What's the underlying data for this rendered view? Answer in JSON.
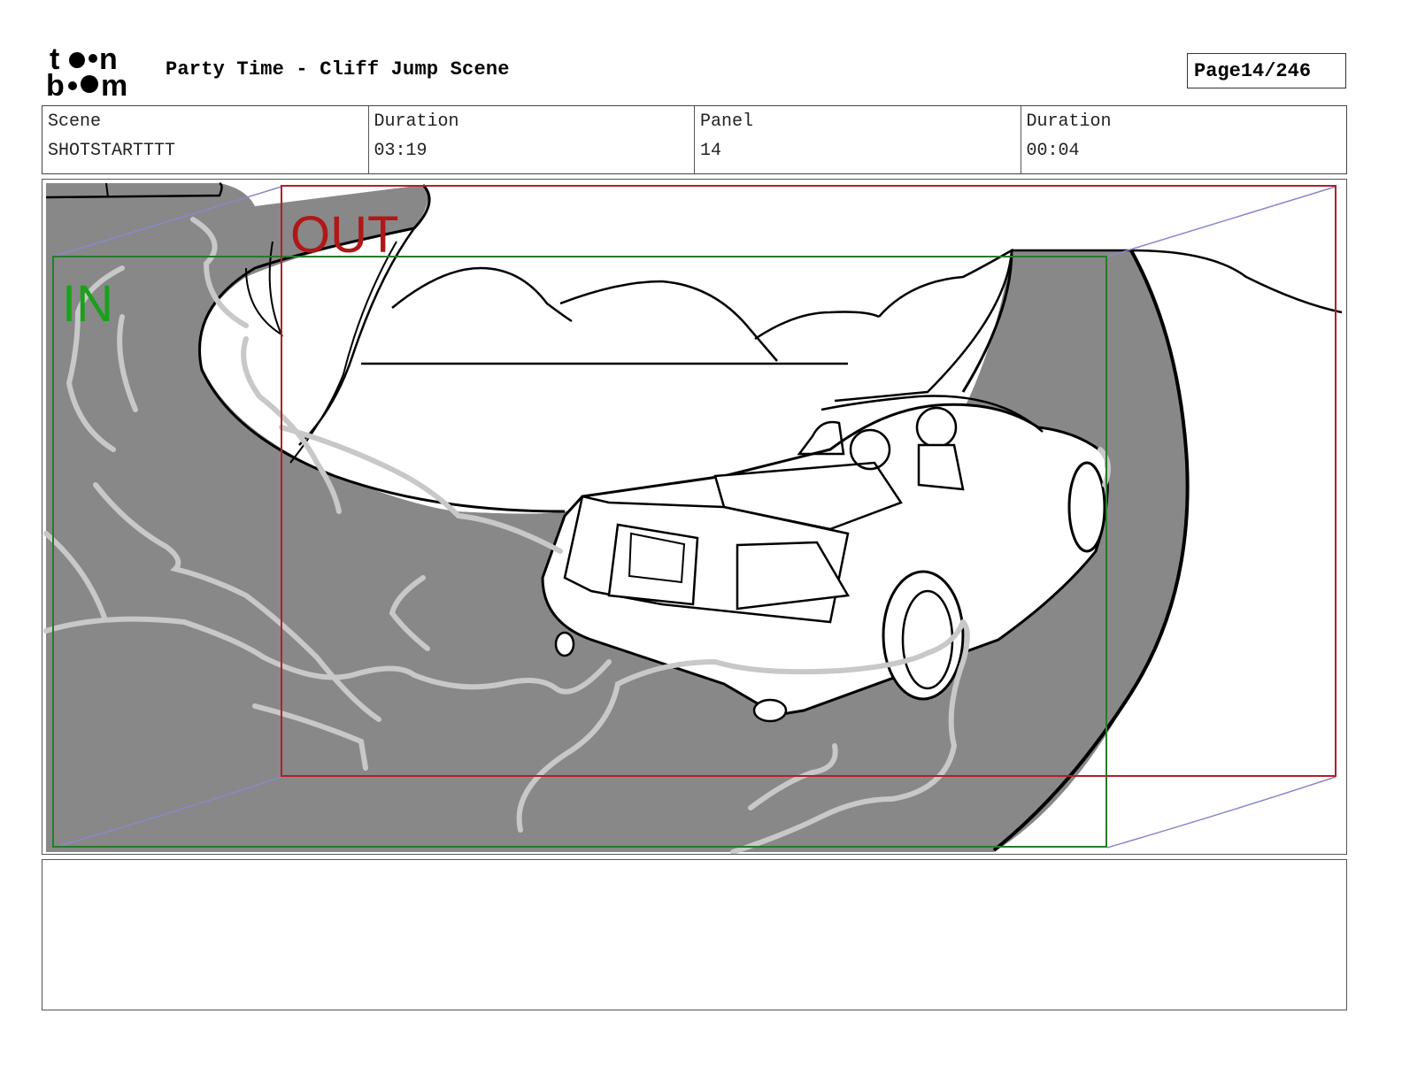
{
  "header": {
    "logo_text": "toon boom",
    "title": "Party Time - Cliff Jump Scene",
    "page_label": "Page",
    "page_number": "14/246"
  },
  "info": {
    "scene_label": "Scene",
    "scene_value": "SHOTSTARTTTT",
    "duration_label": "Duration",
    "duration_value": "03:19",
    "panel_label": "Panel",
    "panel_value": "14",
    "panel_duration_label": "Duration",
    "panel_duration_value": "00:04"
  },
  "panel": {
    "in_label": "IN",
    "out_label": "OUT",
    "colors": {
      "in_frame": "#2a7a2a",
      "in_text": "#1aa01a",
      "out_frame": "#b0202a",
      "out_text": "#b01818",
      "road": "#888888",
      "motion_path": "#8888cc",
      "sketch": "#c8c8c8"
    }
  },
  "notes": {
    "text": ""
  }
}
